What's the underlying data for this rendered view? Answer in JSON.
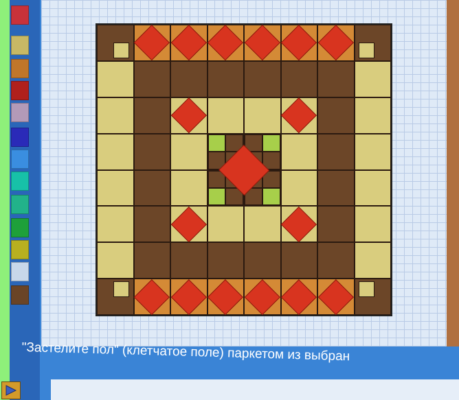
{
  "caption": "\"Застелите пол\" (клетчатое поле) паркетом из выбран",
  "palette": {
    "swatches": [
      {
        "name": "swatch-red-top",
        "color": "#c8323a"
      },
      {
        "name": "swatch-khaki",
        "color": "#c8b865"
      },
      {
        "name": "swatch-orange",
        "color": "#c0762a"
      },
      {
        "name": "swatch-dark-red",
        "color": "#b0201c"
      },
      {
        "name": "swatch-lavender",
        "color": "#b39ab8"
      },
      {
        "name": "swatch-blue",
        "color": "#2a2ab8"
      },
      {
        "name": "swatch-sky",
        "color": "#3a8ee0"
      },
      {
        "name": "swatch-turquoise",
        "color": "#17c1a8"
      },
      {
        "name": "swatch-teal",
        "color": "#22b28a"
      },
      {
        "name": "swatch-green",
        "color": "#1ea03a"
      },
      {
        "name": "swatch-olive",
        "color": "#b8b020"
      },
      {
        "name": "swatch-pale-blue",
        "color": "#c7d7ea"
      },
      {
        "name": "swatch-brown",
        "color": "#6a4426"
      }
    ]
  },
  "floor": {
    "colors": {
      "D": "#6c4628",
      "L": "#d9cd7e",
      "O": "#d48a36",
      "R": "#d8341f",
      "G": "#a7cf4a"
    },
    "rows": [
      [
        "D",
        "O",
        "O",
        "O",
        "O",
        "O",
        "O",
        "D"
      ],
      [
        "L",
        "D",
        "D",
        "D",
        "D",
        "D",
        "D",
        "L"
      ],
      [
        "L",
        "D",
        "L",
        "L",
        "L",
        "L",
        "D",
        "L"
      ],
      [
        "L",
        "D",
        "L",
        "C",
        "C",
        "L",
        "D",
        "L"
      ],
      [
        "L",
        "D",
        "L",
        "C",
        "C",
        "L",
        "D",
        "L"
      ],
      [
        "L",
        "D",
        "L",
        "L",
        "L",
        "L",
        "D",
        "L"
      ],
      [
        "L",
        "D",
        "D",
        "D",
        "D",
        "D",
        "D",
        "L"
      ],
      [
        "D",
        "O",
        "O",
        "O",
        "O",
        "O",
        "O",
        "D"
      ]
    ],
    "diamond_cells": [
      [
        0,
        1
      ],
      [
        0,
        2
      ],
      [
        0,
        3
      ],
      [
        0,
        4
      ],
      [
        0,
        5
      ],
      [
        0,
        6
      ],
      [
        7,
        1
      ],
      [
        7,
        2
      ],
      [
        7,
        3
      ],
      [
        7,
        4
      ],
      [
        7,
        5
      ],
      [
        7,
        6
      ],
      [
        2,
        2
      ],
      [
        2,
        5
      ],
      [
        5,
        2
      ],
      [
        5,
        5
      ]
    ]
  }
}
